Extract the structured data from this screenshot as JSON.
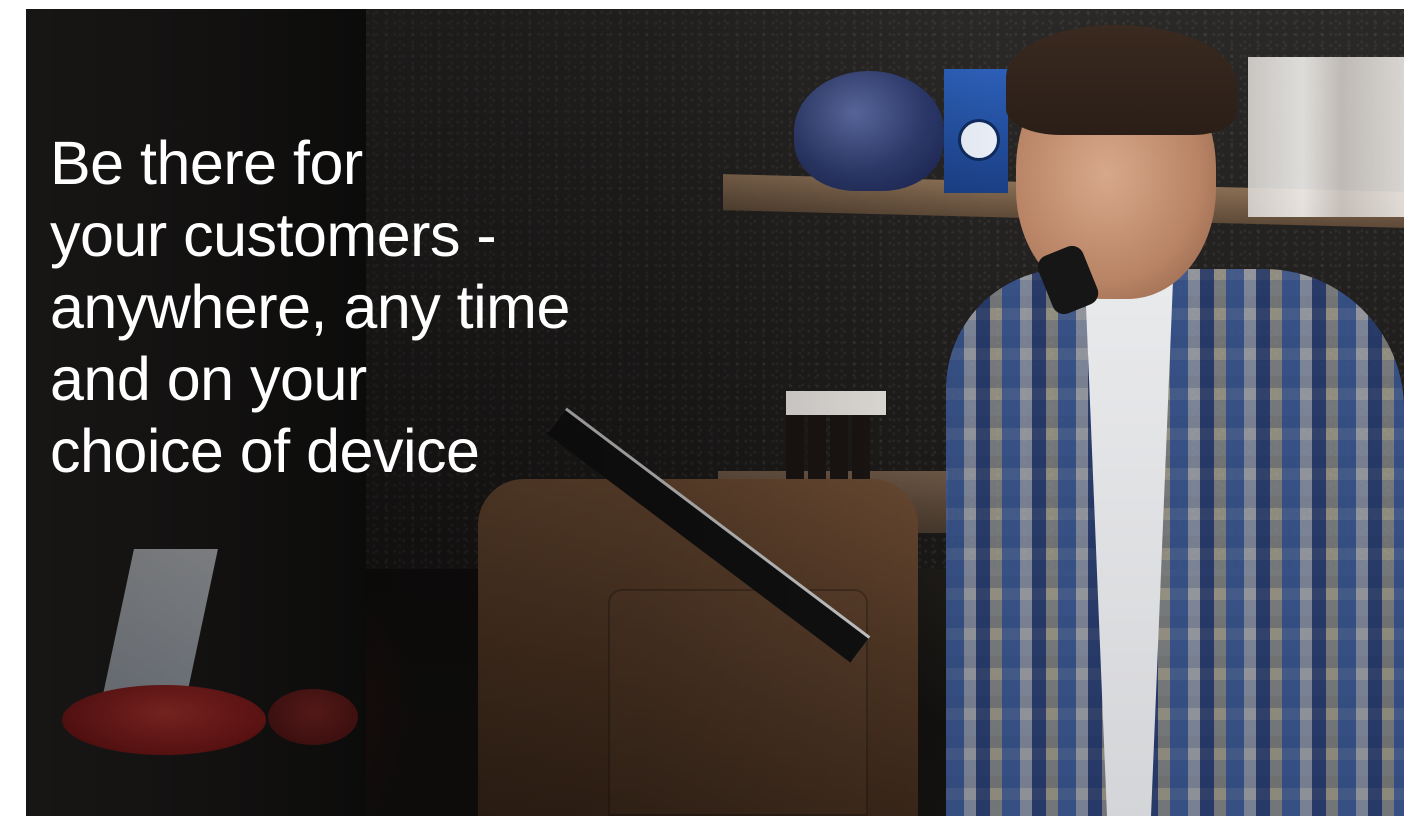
{
  "hero": {
    "headline_lines": [
      "Be there for",
      "your customers -",
      "anywhere, any time",
      "and on your",
      "choice of device"
    ],
    "text_color": "#ffffff",
    "scene_icons": {
      "person": "person-on-phone-icon",
      "register": "cash-register-icon",
      "skull": "skull-ornament-icon",
      "clock": "clock-box-icon"
    }
  }
}
